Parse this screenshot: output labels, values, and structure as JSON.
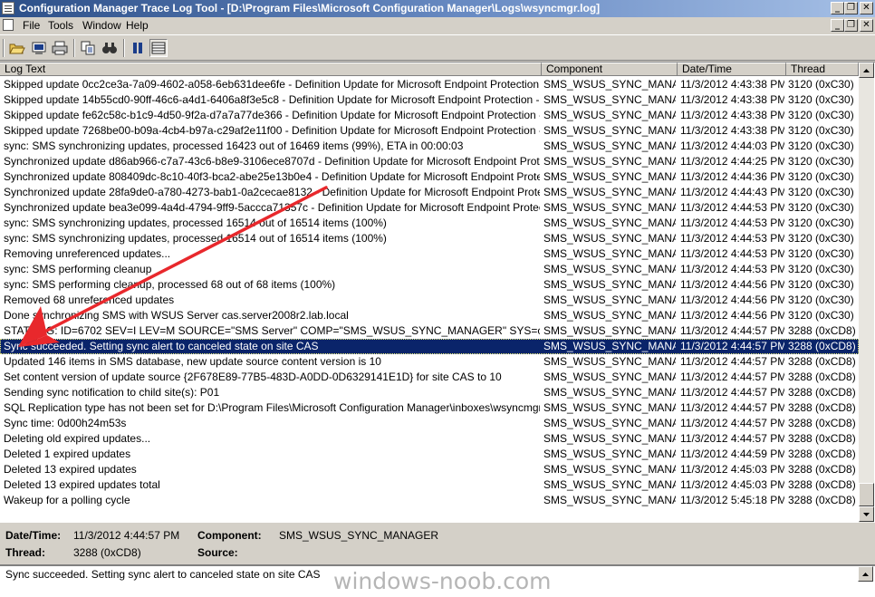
{
  "window": {
    "title": "Configuration Manager Trace Log Tool - [D:\\Program Files\\Microsoft Configuration Manager\\Logs\\wsyncmgr.log]"
  },
  "menu": {
    "items": [
      {
        "label": "File"
      },
      {
        "label": "Tools"
      },
      {
        "label": "Window"
      },
      {
        "label": "Help"
      }
    ]
  },
  "toolbar": {
    "icons": [
      "open-icon",
      "print-preview-icon",
      "print-icon",
      "copy-icon",
      "find-icon",
      "pause-icon",
      "columns-icon"
    ]
  },
  "grid": {
    "columns": [
      "Log Text",
      "Component",
      "Date/Time",
      "Thread"
    ],
    "selected_index": 17,
    "rows": [
      {
        "text": "Skipped update 0cc2ce3a-7a09-4602-a058-6eb631dee6fe - Definition Update for Microsoft Endpoint Protection - KB24614...",
        "component": "SMS_WSUS_SYNC_MANAGI",
        "datetime": "11/3/2012 4:43:38 PM",
        "thread": "3120 (0xC30)"
      },
      {
        "text": "Skipped update 14b55cd0-90ff-46c6-a4d1-6406a8f3e5c8 - Definition Update for Microsoft Endpoint Protection - KB246148...",
        "component": "SMS_WSUS_SYNC_MANAGI",
        "datetime": "11/3/2012 4:43:38 PM",
        "thread": "3120 (0xC30)"
      },
      {
        "text": "Skipped update fe62c58c-b1c9-4d50-9f2a-d7a7a77de366 - Definition Update for Microsoft Endpoint Protection - KB24614...",
        "component": "SMS_WSUS_SYNC_MANAGI",
        "datetime": "11/3/2012 4:43:38 PM",
        "thread": "3120 (0xC30)"
      },
      {
        "text": "Skipped update 7268be00-b09a-4cb4-b97a-c29af2e11f00 - Definition Update for Microsoft Endpoint Protection - KB24614...",
        "component": "SMS_WSUS_SYNC_MANAGI",
        "datetime": "11/3/2012 4:43:38 PM",
        "thread": "3120 (0xC30)"
      },
      {
        "text": "sync: SMS synchronizing updates, processed 16423 out of 16469 items (99%), ETA in 00:00:03",
        "component": "SMS_WSUS_SYNC_MANAGI",
        "datetime": "11/3/2012 4:44:03 PM",
        "thread": "3120 (0xC30)"
      },
      {
        "text": "Synchronized update d86ab966-c7a7-43c6-b8e9-3106ece8707d - Definition Update for Microsoft Endpoint Protection - KB2...",
        "component": "SMS_WSUS_SYNC_MANAGI",
        "datetime": "11/3/2012 4:44:25 PM",
        "thread": "3120 (0xC30)"
      },
      {
        "text": "Synchronized update 808409dc-8c10-40f3-bca2-abe25e13b0e4 - Definition Update for Microsoft Endpoint Protection - KB2...",
        "component": "SMS_WSUS_SYNC_MANAGI",
        "datetime": "11/3/2012 4:44:36 PM",
        "thread": "3120 (0xC30)"
      },
      {
        "text": "Synchronized update 28fa9de0-a780-4273-bab1-0a2cecae8132 - Definition Update for Microsoft Endpoint Protection - KB2...",
        "component": "SMS_WSUS_SYNC_MANAGI",
        "datetime": "11/3/2012 4:44:43 PM",
        "thread": "3120 (0xC30)"
      },
      {
        "text": "Synchronized update bea3e099-4a4d-4794-9ff9-5accca71357c - Definition Update for Microsoft Endpoint Protection - KB2...",
        "component": "SMS_WSUS_SYNC_MANAGI",
        "datetime": "11/3/2012 4:44:53 PM",
        "thread": "3120 (0xC30)"
      },
      {
        "text": "sync: SMS synchronizing updates, processed 16514 out of 16514 items (100%)",
        "component": "SMS_WSUS_SYNC_MANAGI",
        "datetime": "11/3/2012 4:44:53 PM",
        "thread": "3120 (0xC30)"
      },
      {
        "text": "sync: SMS synchronizing updates, processed 16514 out of 16514 items (100%)",
        "component": "SMS_WSUS_SYNC_MANAGI",
        "datetime": "11/3/2012 4:44:53 PM",
        "thread": "3120 (0xC30)"
      },
      {
        "text": "Removing unreferenced updates...",
        "component": "SMS_WSUS_SYNC_MANAGI",
        "datetime": "11/3/2012 4:44:53 PM",
        "thread": "3120 (0xC30)"
      },
      {
        "text": "sync: SMS performing cleanup",
        "component": "SMS_WSUS_SYNC_MANAGI",
        "datetime": "11/3/2012 4:44:53 PM",
        "thread": "3120 (0xC30)"
      },
      {
        "text": "sync: SMS performing cleanup, processed 68 out of 68 items (100%)",
        "component": "SMS_WSUS_SYNC_MANAGI",
        "datetime": "11/3/2012 4:44:56 PM",
        "thread": "3120 (0xC30)"
      },
      {
        "text": "Removed 68 unreferenced updates",
        "component": "SMS_WSUS_SYNC_MANAGI",
        "datetime": "11/3/2012 4:44:56 PM",
        "thread": "3120 (0xC30)"
      },
      {
        "text": "Done synchronizing SMS with WSUS Server cas.server2008r2.lab.local",
        "component": "SMS_WSUS_SYNC_MANAGI",
        "datetime": "11/3/2012 4:44:56 PM",
        "thread": "3120 (0xC30)"
      },
      {
        "text": "STATMSG: ID=6702 SEV=I LEV=M SOURCE=\"SMS Server\" COMP=\"SMS_WSUS_SYNC_MANAGER\" SYS=cas.server...",
        "component": "SMS_WSUS_SYNC_MANAGI",
        "datetime": "11/3/2012 4:44:57 PM",
        "thread": "3288 (0xCD8)"
      },
      {
        "text": "Sync succeeded. Setting sync alert to canceled state on site CAS",
        "component": "SMS_WSUS_SYNC_MANAGI",
        "datetime": "11/3/2012 4:44:57 PM",
        "thread": "3288 (0xCD8)"
      },
      {
        "text": "Updated 146 items in SMS database, new update source content version is 10",
        "component": "SMS_WSUS_SYNC_MANAGI",
        "datetime": "11/3/2012 4:44:57 PM",
        "thread": "3288 (0xCD8)"
      },
      {
        "text": "Set content version of update source {2F678E89-77B5-483D-A0DD-0D6329141E1D} for site CAS to 10",
        "component": "SMS_WSUS_SYNC_MANAGI",
        "datetime": "11/3/2012 4:44:57 PM",
        "thread": "3288 (0xCD8)"
      },
      {
        "text": "Sending sync notification to child site(s): P01",
        "component": "SMS_WSUS_SYNC_MANAGI",
        "datetime": "11/3/2012 4:44:57 PM",
        "thread": "3288 (0xCD8)"
      },
      {
        "text": "SQL Replication type has not been set for D:\\Program Files\\Microsoft Configuration Manager\\inboxes\\wsyncmgr.box\\outb...",
        "component": "SMS_WSUS_SYNC_MANAGI",
        "datetime": "11/3/2012 4:44:57 PM",
        "thread": "3288 (0xCD8)"
      },
      {
        "text": "Sync time: 0d00h24m53s",
        "component": "SMS_WSUS_SYNC_MANAGI",
        "datetime": "11/3/2012 4:44:57 PM",
        "thread": "3288 (0xCD8)"
      },
      {
        "text": "Deleting old expired updates...",
        "component": "SMS_WSUS_SYNC_MANAGI",
        "datetime": "11/3/2012 4:44:57 PM",
        "thread": "3288 (0xCD8)"
      },
      {
        "text": "Deleted 1 expired updates",
        "component": "SMS_WSUS_SYNC_MANAGI",
        "datetime": "11/3/2012 4:44:59 PM",
        "thread": "3288 (0xCD8)"
      },
      {
        "text": "Deleted 13 expired updates",
        "component": "SMS_WSUS_SYNC_MANAGI",
        "datetime": "11/3/2012 4:45:03 PM",
        "thread": "3288 (0xCD8)"
      },
      {
        "text": "Deleted 13 expired updates total",
        "component": "SMS_WSUS_SYNC_MANAGI",
        "datetime": "11/3/2012 4:45:03 PM",
        "thread": "3288 (0xCD8)"
      },
      {
        "text": "Wakeup for a polling cycle",
        "component": "SMS_WSUS_SYNC_MANAGI",
        "datetime": "11/3/2012 5:45:18 PM",
        "thread": "3288 (0xCD8)"
      }
    ]
  },
  "details": {
    "datetime_label": "Date/Time:",
    "datetime_value": "11/3/2012 4:44:57 PM",
    "component_label": "Component:",
    "component_value": "SMS_WSUS_SYNC_MANAGER",
    "thread_label": "Thread:",
    "thread_value": "3288 (0xCD8)",
    "source_label": "Source:",
    "source_value": ""
  },
  "message": {
    "text": "Sync succeeded. Setting sync alert to canceled state on site CAS"
  },
  "watermark": "windows-noob.com",
  "colors": {
    "selection": "#0a246a",
    "arrow": "#e8282c"
  }
}
